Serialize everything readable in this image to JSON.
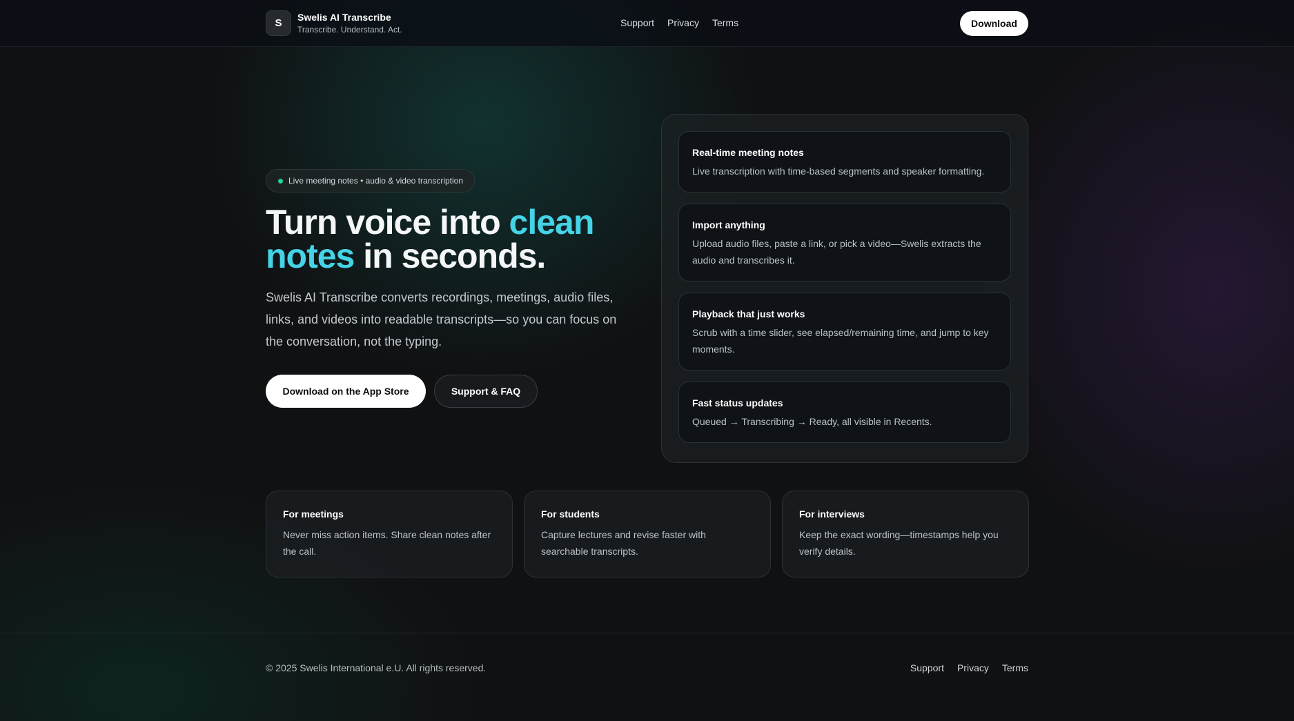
{
  "header": {
    "logo_letter": "S",
    "app_name": "Swelis AI Transcribe",
    "tagline": "Transcribe. Understand. Act.",
    "nav": [
      "Support",
      "Privacy",
      "Terms"
    ],
    "download_label": "Download"
  },
  "hero": {
    "badge": "Live meeting notes • audio & video transcription",
    "title_part1": "Turn voice into ",
    "title_accent": "clean notes",
    "title_part2": " in seconds.",
    "description": "Swelis AI Transcribe converts recordings, meetings, audio files, links, and videos into readable transcripts—so you can focus on the conversation, not the typing.",
    "primary_cta": "Download on the App Store",
    "secondary_cta": "Support & FAQ"
  },
  "features": [
    {
      "title": "Real-time meeting notes",
      "description": "Live transcription with time-based segments and speaker formatting."
    },
    {
      "title": "Import anything",
      "description": "Upload audio files, paste a link, or pick a video—Swelis extracts the audio and transcribes it."
    },
    {
      "title": "Playback that just works",
      "description": "Scrub with a time slider, see elapsed/remaining time, and jump to key moments."
    },
    {
      "title": "Fast status updates",
      "description": "Queued → Transcribing → Ready, all visible in Recents."
    }
  ],
  "audiences": [
    {
      "title": "For meetings",
      "description": "Never miss action items. Share clean notes after the call."
    },
    {
      "title": "For students",
      "description": "Capture lectures and revise faster with searchable transcripts."
    },
    {
      "title": "For interviews",
      "description": "Keep the exact wording—timestamps help you verify details."
    }
  ],
  "footer": {
    "copyright": "© 2025 Swelis International e.U. All rights reserved.",
    "nav": [
      "Support",
      "Privacy",
      "Terms"
    ]
  },
  "colors": {
    "accent": "#45d3e6",
    "badge_dot": "#22d39b",
    "background": "#101113"
  }
}
